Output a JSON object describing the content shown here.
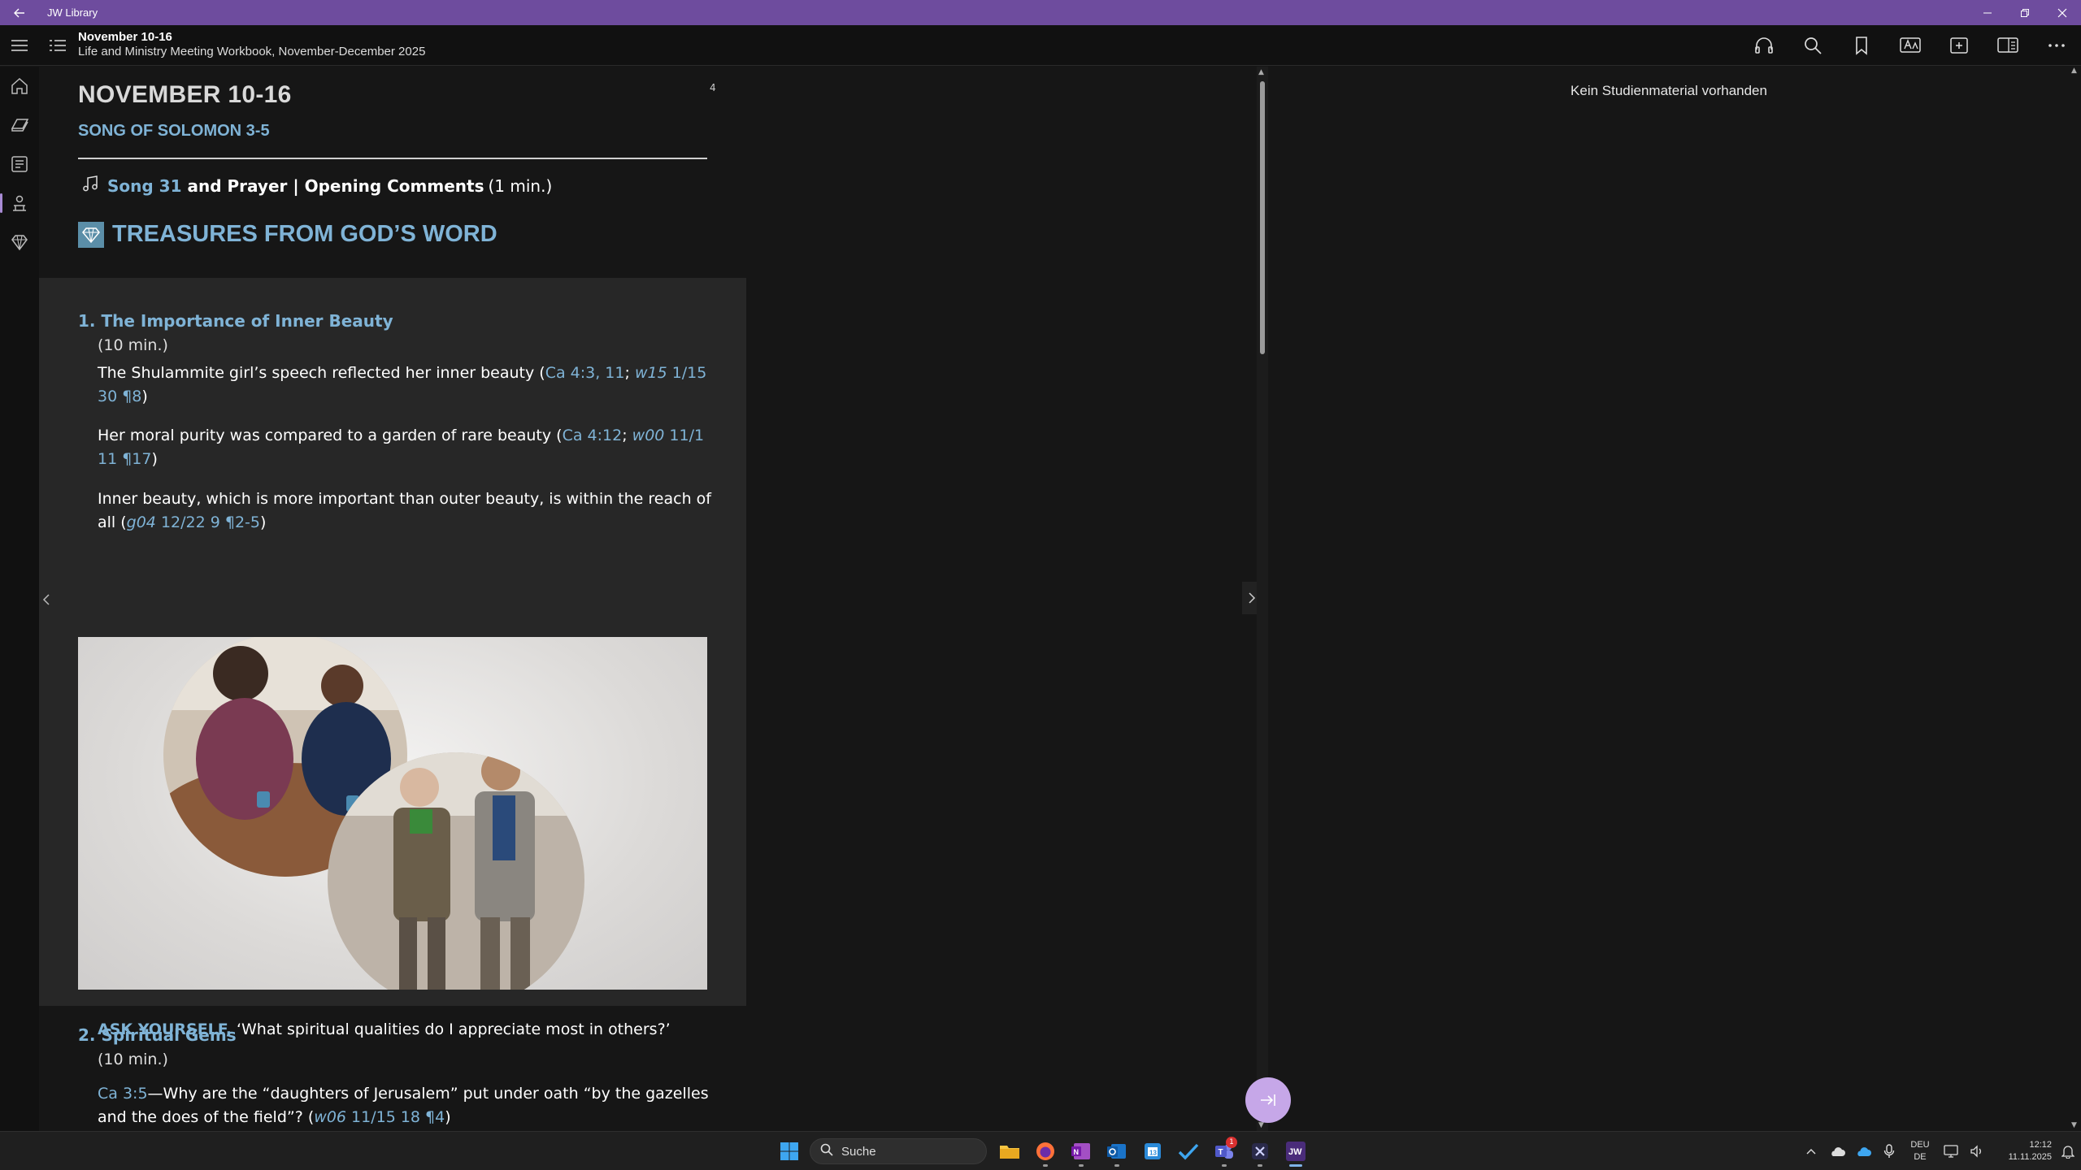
{
  "titlebar": {
    "title": "JW Library"
  },
  "header": {
    "title": "November 10-16",
    "subtitle": "Life and Ministry Meeting Workbook, November-December 2025"
  },
  "article": {
    "page_number": "4",
    "date": "NOVEMBER 10-16",
    "bible_reading": "SONG OF SOLOMON 3-5",
    "song": {
      "song_label": "Song 31",
      "rest": "and Prayer | Opening Comments",
      "duration": "(1 min.)"
    },
    "section_heading": "TREASURES FROM GOD’S WORD",
    "part1": {
      "title": "1. The Importance of Inner Beauty",
      "duration": "(10 min.)",
      "p1": {
        "text": "The Shulammite girl’s speech reflected her inner beauty (",
        "ref1": "Ca 4:3, 11",
        "sep": "; ",
        "ref2_it": "w15",
        "ref2": " 1/15 30 ¶8",
        "end": ")"
      },
      "p2": {
        "text": "Her moral purity was compared to a garden of rare beauty (",
        "ref1": "Ca 4:12",
        "sep": "; ",
        "ref2_it": "w00",
        "ref2": " 11/1 11 ¶17",
        "end": ")"
      },
      "p3": {
        "text": "Inner beauty, which is more important than outer beauty, is within the reach of all (",
        "ref_it": "g04",
        "ref": " 12/22 9 ¶2-5",
        "end": ")"
      },
      "ask_label": "ASK YOURSELF,",
      "ask_text": " ‘What spiritual qualities do I appreciate most in others?’"
    },
    "part2": {
      "title": "2. Spiritual Gems",
      "duration": "(10 min.)",
      "ref": "Ca 3:5",
      "text": "—Why are the “daughters of Jerusalem” put under oath “by the gazelles and the does of the field”? (",
      "ref2_it": "w06",
      "ref2": " 11/15 18 ¶4",
      "end": ")"
    }
  },
  "study_pane": {
    "message": "Kein Studienmaterial vorhanden"
  },
  "taskbar": {
    "search_placeholder": "Suche",
    "lang_top": "DEU",
    "lang_bottom": "DE",
    "time": "12:12",
    "date": "11.11.2025",
    "teams_badge": "1"
  },
  "colors": {
    "accent_purple": "#6e4c9e",
    "link_blue": "#7fb3d6",
    "split_button": "#c6a7e8"
  }
}
